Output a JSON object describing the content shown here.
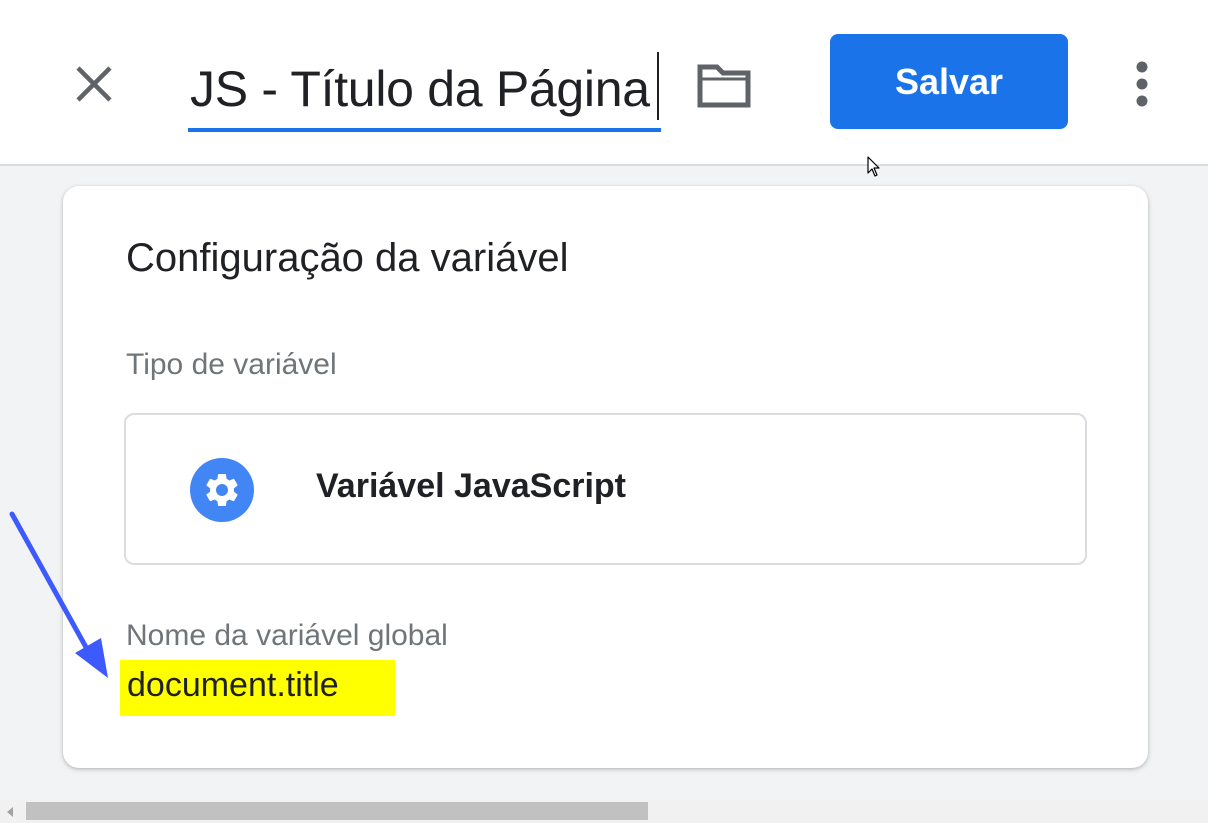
{
  "header": {
    "close_icon": "close-icon",
    "variable_name": "JS - Título da Página",
    "folder_icon": "folder-icon",
    "save_label": "Salvar",
    "more_icon": "more-vert-icon"
  },
  "card": {
    "title": "Configuração da variável",
    "type_label": "Tipo de variável",
    "type": {
      "icon": "gear-icon",
      "name": "Variável JavaScript"
    },
    "global_label": "Nome da variável global",
    "global_value": "document.title"
  },
  "colors": {
    "accent": "#1a73e8",
    "gear_circle": "#4285f4",
    "highlight": "#ffff00",
    "annotation_arrow": "#3d5afe"
  }
}
